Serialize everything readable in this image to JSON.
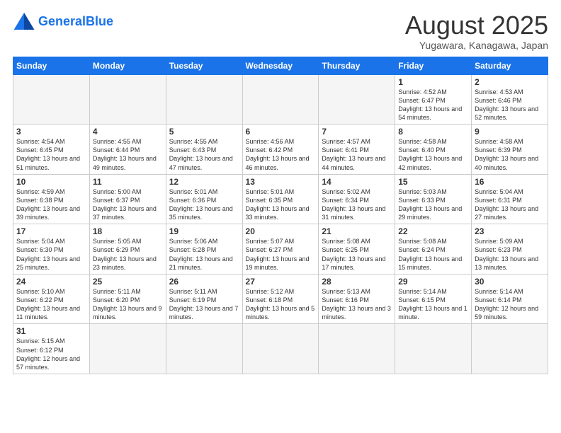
{
  "logo": {
    "text_general": "General",
    "text_blue": "Blue"
  },
  "title": "August 2025",
  "location": "Yugawara, Kanagawa, Japan",
  "weekdays": [
    "Sunday",
    "Monday",
    "Tuesday",
    "Wednesday",
    "Thursday",
    "Friday",
    "Saturday"
  ],
  "weeks": [
    [
      {
        "day": "",
        "info": "",
        "empty": true
      },
      {
        "day": "",
        "info": "",
        "empty": true
      },
      {
        "day": "",
        "info": "",
        "empty": true
      },
      {
        "day": "",
        "info": "",
        "empty": true
      },
      {
        "day": "",
        "info": "",
        "empty": true
      },
      {
        "day": "1",
        "info": "Sunrise: 4:52 AM\nSunset: 6:47 PM\nDaylight: 13 hours and 54 minutes."
      },
      {
        "day": "2",
        "info": "Sunrise: 4:53 AM\nSunset: 6:46 PM\nDaylight: 13 hours and 52 minutes."
      }
    ],
    [
      {
        "day": "3",
        "info": "Sunrise: 4:54 AM\nSunset: 6:45 PM\nDaylight: 13 hours and 51 minutes."
      },
      {
        "day": "4",
        "info": "Sunrise: 4:55 AM\nSunset: 6:44 PM\nDaylight: 13 hours and 49 minutes."
      },
      {
        "day": "5",
        "info": "Sunrise: 4:55 AM\nSunset: 6:43 PM\nDaylight: 13 hours and 47 minutes."
      },
      {
        "day": "6",
        "info": "Sunrise: 4:56 AM\nSunset: 6:42 PM\nDaylight: 13 hours and 46 minutes."
      },
      {
        "day": "7",
        "info": "Sunrise: 4:57 AM\nSunset: 6:41 PM\nDaylight: 13 hours and 44 minutes."
      },
      {
        "day": "8",
        "info": "Sunrise: 4:58 AM\nSunset: 6:40 PM\nDaylight: 13 hours and 42 minutes."
      },
      {
        "day": "9",
        "info": "Sunrise: 4:58 AM\nSunset: 6:39 PM\nDaylight: 13 hours and 40 minutes."
      }
    ],
    [
      {
        "day": "10",
        "info": "Sunrise: 4:59 AM\nSunset: 6:38 PM\nDaylight: 13 hours and 39 minutes."
      },
      {
        "day": "11",
        "info": "Sunrise: 5:00 AM\nSunset: 6:37 PM\nDaylight: 13 hours and 37 minutes."
      },
      {
        "day": "12",
        "info": "Sunrise: 5:01 AM\nSunset: 6:36 PM\nDaylight: 13 hours and 35 minutes."
      },
      {
        "day": "13",
        "info": "Sunrise: 5:01 AM\nSunset: 6:35 PM\nDaylight: 13 hours and 33 minutes."
      },
      {
        "day": "14",
        "info": "Sunrise: 5:02 AM\nSunset: 6:34 PM\nDaylight: 13 hours and 31 minutes."
      },
      {
        "day": "15",
        "info": "Sunrise: 5:03 AM\nSunset: 6:33 PM\nDaylight: 13 hours and 29 minutes."
      },
      {
        "day": "16",
        "info": "Sunrise: 5:04 AM\nSunset: 6:31 PM\nDaylight: 13 hours and 27 minutes."
      }
    ],
    [
      {
        "day": "17",
        "info": "Sunrise: 5:04 AM\nSunset: 6:30 PM\nDaylight: 13 hours and 25 minutes."
      },
      {
        "day": "18",
        "info": "Sunrise: 5:05 AM\nSunset: 6:29 PM\nDaylight: 13 hours and 23 minutes."
      },
      {
        "day": "19",
        "info": "Sunrise: 5:06 AM\nSunset: 6:28 PM\nDaylight: 13 hours and 21 minutes."
      },
      {
        "day": "20",
        "info": "Sunrise: 5:07 AM\nSunset: 6:27 PM\nDaylight: 13 hours and 19 minutes."
      },
      {
        "day": "21",
        "info": "Sunrise: 5:08 AM\nSunset: 6:25 PM\nDaylight: 13 hours and 17 minutes."
      },
      {
        "day": "22",
        "info": "Sunrise: 5:08 AM\nSunset: 6:24 PM\nDaylight: 13 hours and 15 minutes."
      },
      {
        "day": "23",
        "info": "Sunrise: 5:09 AM\nSunset: 6:23 PM\nDaylight: 13 hours and 13 minutes."
      }
    ],
    [
      {
        "day": "24",
        "info": "Sunrise: 5:10 AM\nSunset: 6:22 PM\nDaylight: 13 hours and 11 minutes."
      },
      {
        "day": "25",
        "info": "Sunrise: 5:11 AM\nSunset: 6:20 PM\nDaylight: 13 hours and 9 minutes."
      },
      {
        "day": "26",
        "info": "Sunrise: 5:11 AM\nSunset: 6:19 PM\nDaylight: 13 hours and 7 minutes."
      },
      {
        "day": "27",
        "info": "Sunrise: 5:12 AM\nSunset: 6:18 PM\nDaylight: 13 hours and 5 minutes."
      },
      {
        "day": "28",
        "info": "Sunrise: 5:13 AM\nSunset: 6:16 PM\nDaylight: 13 hours and 3 minutes."
      },
      {
        "day": "29",
        "info": "Sunrise: 5:14 AM\nSunset: 6:15 PM\nDaylight: 13 hours and 1 minute."
      },
      {
        "day": "30",
        "info": "Sunrise: 5:14 AM\nSunset: 6:14 PM\nDaylight: 12 hours and 59 minutes."
      }
    ],
    [
      {
        "day": "31",
        "info": "Sunrise: 5:15 AM\nSunset: 6:12 PM\nDaylight: 12 hours and 57 minutes."
      },
      {
        "day": "",
        "info": "",
        "empty": true
      },
      {
        "day": "",
        "info": "",
        "empty": true
      },
      {
        "day": "",
        "info": "",
        "empty": true
      },
      {
        "day": "",
        "info": "",
        "empty": true
      },
      {
        "day": "",
        "info": "",
        "empty": true
      },
      {
        "day": "",
        "info": "",
        "empty": true
      }
    ]
  ]
}
